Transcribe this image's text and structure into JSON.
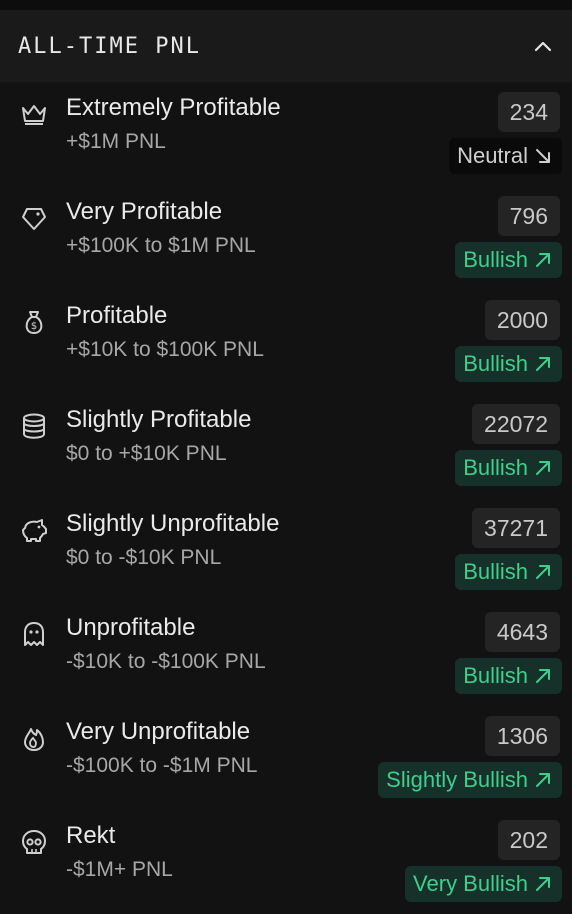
{
  "header": {
    "title": "ALL-TIME PNL"
  },
  "rows": [
    {
      "icon": "crown-icon",
      "title": "Extremely Profitable",
      "subtitle": "+$1M PNL",
      "count": "234",
      "sentiment": "Neutral",
      "trend": "down"
    },
    {
      "icon": "gem-icon",
      "title": "Very Profitable",
      "subtitle": "+$100K to $1M PNL",
      "count": "796",
      "sentiment": "Bullish",
      "trend": "up"
    },
    {
      "icon": "money-bag-icon",
      "title": "Profitable",
      "subtitle": "+$10K to $100K PNL",
      "count": "2000",
      "sentiment": "Bullish",
      "trend": "up"
    },
    {
      "icon": "coin-stack-icon",
      "title": "Slightly Profitable",
      "subtitle": "$0 to +$10K PNL",
      "count": "22072",
      "sentiment": "Bullish",
      "trend": "up"
    },
    {
      "icon": "piggy-bank-icon",
      "title": "Slightly Unprofitable",
      "subtitle": "$0 to -$10K PNL",
      "count": "37271",
      "sentiment": "Bullish",
      "trend": "up"
    },
    {
      "icon": "ghost-icon",
      "title": "Unprofitable",
      "subtitle": "-$10K to -$100K PNL",
      "count": "4643",
      "sentiment": "Bullish",
      "trend": "up"
    },
    {
      "icon": "flame-icon",
      "title": "Very Unprofitable",
      "subtitle": "-$100K to -$1M PNL",
      "count": "1306",
      "sentiment": "Slightly Bullish",
      "trend": "up"
    },
    {
      "icon": "skull-icon",
      "title": "Rekt",
      "subtitle": "-$1M+ PNL",
      "count": "202",
      "sentiment": "Very Bullish",
      "trend": "up"
    }
  ],
  "colors": {
    "bullish": "#3ecf8e",
    "neutral": "#cfcfcf",
    "background": "#121212"
  }
}
